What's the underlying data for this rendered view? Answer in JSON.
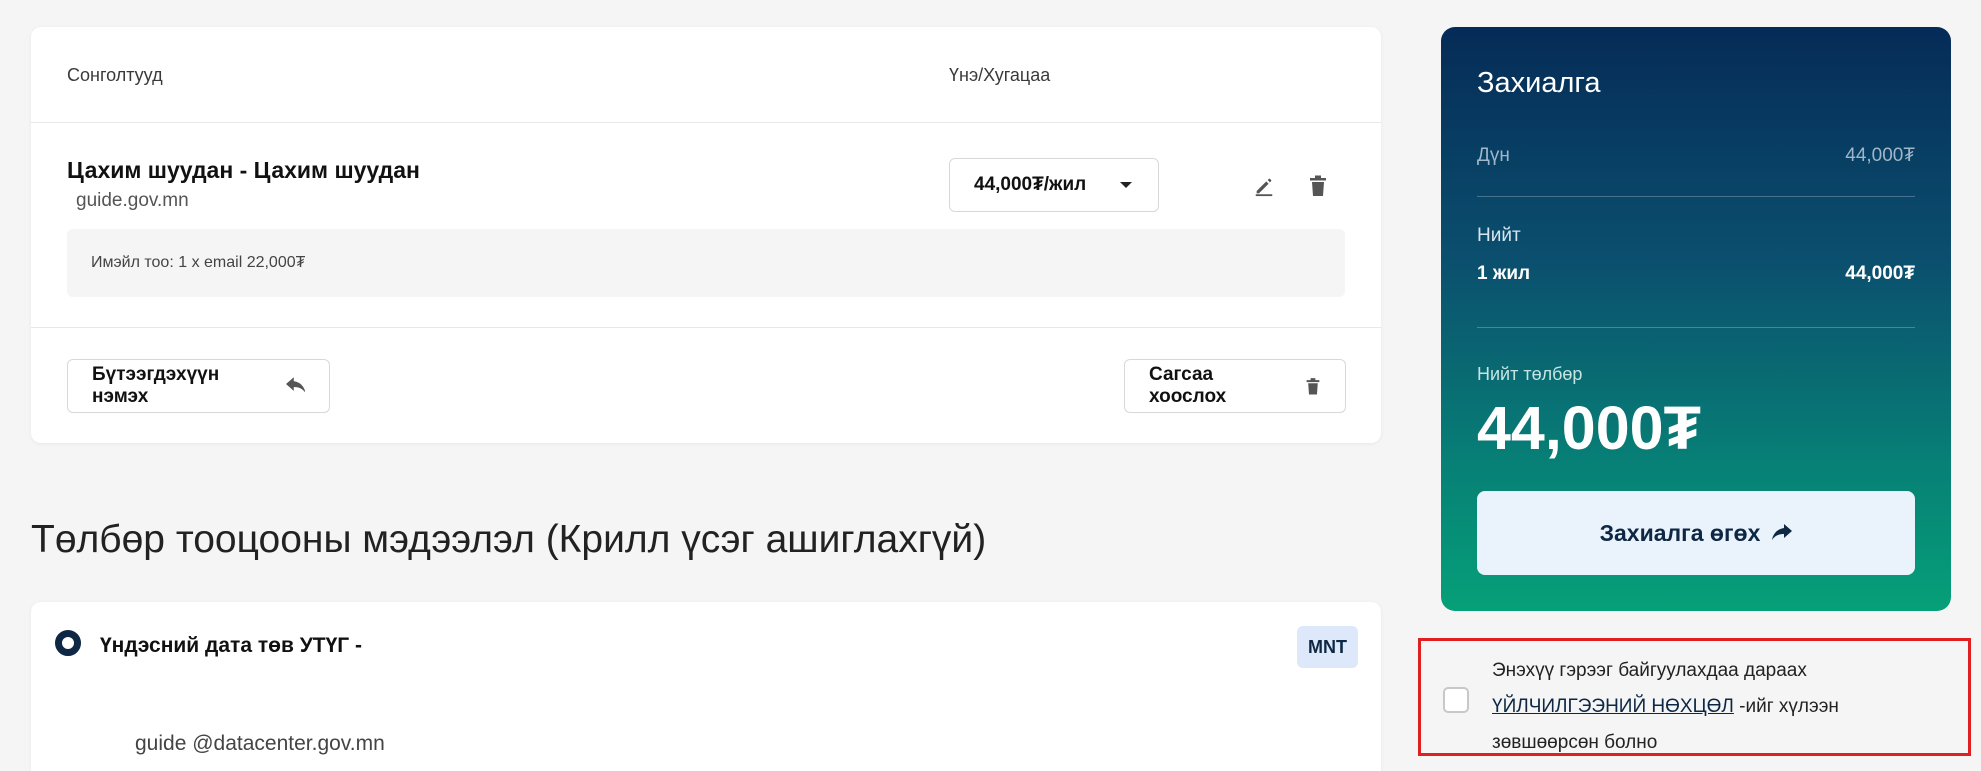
{
  "cart": {
    "col_options": "Сонголтууд",
    "col_price": "Үнэ/Хугацаа",
    "item": {
      "title": "Цахим шуудан - Цахим шуудан",
      "domain": "guide.gov.mn",
      "price_option": "44,000₮/жил",
      "extra": "Имэйл тоо: 1 x email 22,000₮"
    },
    "add_product_label": "Бүтээгдэхүүн нэмэх",
    "clear_cart_label": "Сагсаа хоослох"
  },
  "billing": {
    "section_title": "Төлбөр тооцооны мэдээлэл (Крилл үсэг ашиглахгүй)",
    "payer_name": "Үндэсний дата төв УТҮГ -",
    "currency_badge": "MNT",
    "email": "guide @datacenter.gov.mn"
  },
  "order": {
    "title": "Захиалга",
    "subtotal_label": "Дүн",
    "subtotal_value": "44,000₮",
    "total_label": "Нийт",
    "period_label": "1 жил",
    "period_value": "44,000₮",
    "pay_total_label": "Нийт төлбөр",
    "pay_total_value": "44,000₮",
    "submit_label": "Захиалга өгөх"
  },
  "terms": {
    "text_before": "Энэхүү гэрээг байгуулахдаа дараах",
    "link_text": "ҮЙЛЧИЛГЭЭНИЙ НӨХЦӨЛ",
    "text_after": "-ийг хүлээн зөвшөөрсөн болно",
    "checked": false
  },
  "colors": {
    "accent_dark": "#0d2744",
    "order_gradient_top": "#052b57",
    "order_gradient_bottom": "#06a078",
    "highlight_border": "#e02020"
  }
}
